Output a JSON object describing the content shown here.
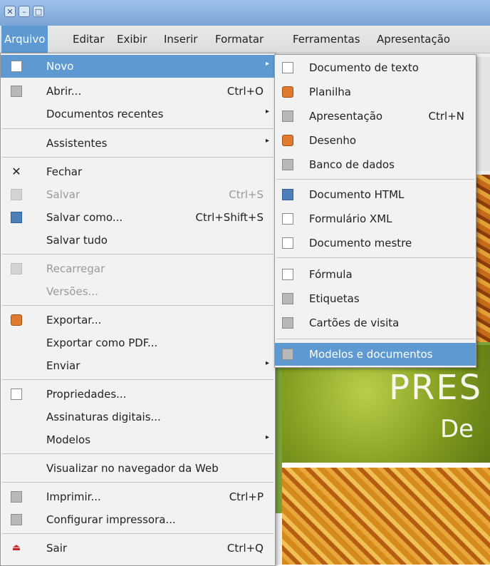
{
  "window": {
    "buttons": [
      "✕",
      "–",
      "□"
    ]
  },
  "menubar": {
    "items": [
      {
        "label": "Arquivo"
      },
      {
        "label": "Editar"
      },
      {
        "label": "Exibir"
      },
      {
        "label": "Inserir"
      },
      {
        "label": "Formatar"
      },
      {
        "label": "Ferramentas"
      },
      {
        "label": "Apresentação"
      }
    ]
  },
  "slide": {
    "title": "PRES",
    "subtitle": "De"
  },
  "file_menu": {
    "items": [
      {
        "label": "Novo",
        "shortcut": "",
        "submenu": true,
        "icon": "new-document-icon"
      },
      {
        "label": "Abrir...",
        "shortcut": "Ctrl+O",
        "submenu": false,
        "icon": "open-folder-icon"
      },
      {
        "label": "Documentos recentes",
        "shortcut": "",
        "submenu": true,
        "icon": ""
      },
      {
        "label": "Assistentes",
        "shortcut": "",
        "submenu": true,
        "icon": ""
      },
      {
        "label": "Fechar",
        "shortcut": "",
        "submenu": false,
        "icon": "close-x-icon"
      },
      {
        "label": "Salvar",
        "shortcut": "Ctrl+S",
        "submenu": false,
        "icon": "save-disk-icon",
        "disabled": true
      },
      {
        "label": "Salvar como...",
        "shortcut": "Ctrl+Shift+S",
        "submenu": false,
        "icon": "save-as-icon"
      },
      {
        "label": "Salvar tudo",
        "shortcut": "",
        "submenu": false,
        "icon": ""
      },
      {
        "label": "Recarregar",
        "shortcut": "",
        "submenu": false,
        "icon": "reload-icon",
        "disabled": true
      },
      {
        "label": "Versões...",
        "shortcut": "",
        "submenu": false,
        "icon": "",
        "disabled": true
      },
      {
        "label": "Exportar...",
        "shortcut": "",
        "submenu": false,
        "icon": "export-icon"
      },
      {
        "label": "Exportar como PDF...",
        "shortcut": "",
        "submenu": false,
        "icon": ""
      },
      {
        "label": "Enviar",
        "shortcut": "",
        "submenu": true,
        "icon": ""
      },
      {
        "label": "Propriedades...",
        "shortcut": "",
        "submenu": false,
        "icon": "properties-icon"
      },
      {
        "label": "Assinaturas digitais...",
        "shortcut": "",
        "submenu": false,
        "icon": ""
      },
      {
        "label": "Modelos",
        "shortcut": "",
        "submenu": true,
        "icon": ""
      },
      {
        "label": "Visualizar no navegador da Web",
        "shortcut": "",
        "submenu": false,
        "icon": ""
      },
      {
        "label": "Imprimir...",
        "shortcut": "Ctrl+P",
        "submenu": false,
        "icon": "printer-icon"
      },
      {
        "label": "Configurar impressora...",
        "shortcut": "",
        "submenu": false,
        "icon": "printer-setup-icon"
      },
      {
        "label": "Sair",
        "shortcut": "Ctrl+Q",
        "submenu": false,
        "icon": "exit-icon"
      }
    ]
  },
  "new_submenu": {
    "items": [
      {
        "label": "Documento de texto",
        "shortcut": ""
      },
      {
        "label": "Planilha",
        "shortcut": ""
      },
      {
        "label": "Apresentação",
        "shortcut": "Ctrl+N"
      },
      {
        "label": "Desenho",
        "shortcut": ""
      },
      {
        "label": "Banco de dados",
        "shortcut": ""
      },
      {
        "label": "Documento HTML",
        "shortcut": ""
      },
      {
        "label": "Formulário XML",
        "shortcut": ""
      },
      {
        "label": "Documento mestre",
        "shortcut": ""
      },
      {
        "label": "Fórmula",
        "shortcut": ""
      },
      {
        "label": "Etiquetas",
        "shortcut": ""
      },
      {
        "label": "Cartões de visita",
        "shortcut": ""
      },
      {
        "label": "Modelos e documentos",
        "shortcut": ""
      }
    ]
  }
}
